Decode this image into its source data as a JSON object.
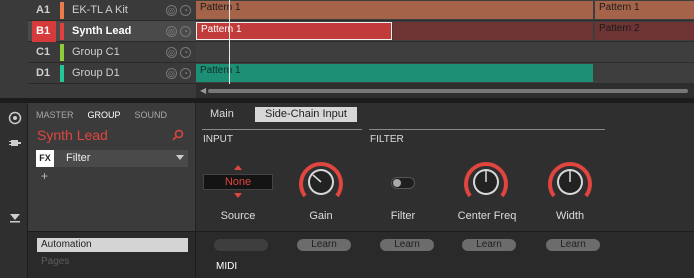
{
  "arranger": {
    "tracks": [
      {
        "slot": "A1",
        "name": "EK-TL A Kit",
        "color": "#e87b4a"
      },
      {
        "slot": "B1",
        "name": "Synth Lead",
        "color": "#e04040"
      },
      {
        "slot": "C1",
        "name": "Group C1",
        "color": "#8ecb3a"
      },
      {
        "slot": "D1",
        "name": "Group D1",
        "color": "#25c59a"
      }
    ],
    "clips": {
      "a_pattern1": "Pattern 1",
      "a_pattern1_end": "Pattern 1",
      "b_pattern1": "Pattern 1",
      "b_pattern2": "Pattern 2",
      "d_pattern1": "Pattern 1"
    }
  },
  "control": {
    "tabs": [
      "MASTER",
      "GROUP",
      "SOUND"
    ],
    "active_tab": "GROUP",
    "title": "Synth Lead",
    "fx_badge": "FX",
    "plugin": "Filter",
    "add": "+",
    "page_tabs": [
      "Main",
      "Side-Chain Input"
    ],
    "active_page_tab": "Side-Chain Input",
    "sections": {
      "input": "INPUT",
      "filter": "FILTER"
    },
    "source_value": "None",
    "labels": {
      "source": "Source",
      "gain": "Gain",
      "filter": "Filter",
      "center_freq": "Center Freq",
      "width": "Width"
    }
  },
  "bottom": {
    "automation": "Automation",
    "pages": "Pages",
    "learn": [
      "Learn",
      "Learn",
      "Learn",
      "Learn"
    ],
    "midi": "MIDI"
  },
  "colors": {
    "accent": "#e0453f",
    "clip_brown": "#a5644a",
    "clip_red": "#c23b3b",
    "clip_green": "#1c8f74"
  }
}
